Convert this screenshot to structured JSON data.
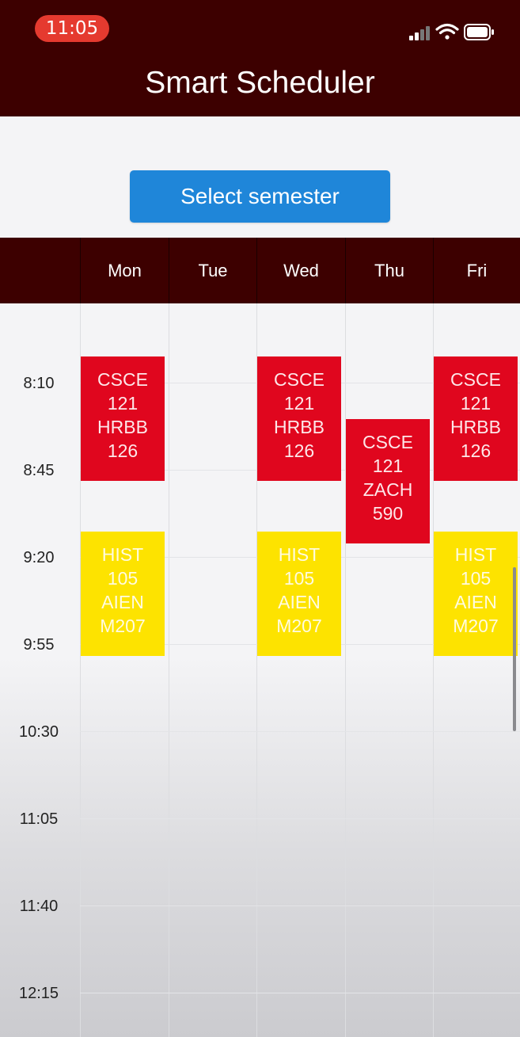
{
  "status_bar": {
    "time": "11:05",
    "icons": [
      "signal-icon",
      "wifi-icon",
      "battery-icon"
    ]
  },
  "header": {
    "title": "Smart Scheduler"
  },
  "semester_button": {
    "label": "Select semester"
  },
  "days": [
    "Mon",
    "Tue",
    "Wed",
    "Thu",
    "Fri"
  ],
  "time_labels": [
    "8:10",
    "8:45",
    "9:20",
    "9:55",
    "10:30",
    "11:05",
    "11:40",
    "12:15"
  ],
  "events": [
    {
      "day": "Mon",
      "lines": [
        "CSCE",
        "121",
        "HRBB",
        "126"
      ],
      "color": "red"
    },
    {
      "day": "Wed",
      "lines": [
        "CSCE",
        "121",
        "HRBB",
        "126"
      ],
      "color": "red"
    },
    {
      "day": "Fri",
      "lines": [
        "CSCE",
        "121",
        "HRBB",
        "126"
      ],
      "color": "red"
    },
    {
      "day": "Thu",
      "lines": [
        "CSCE",
        "121",
        "ZACH",
        "590"
      ],
      "color": "red"
    },
    {
      "day": "Mon",
      "lines": [
        "HIST",
        "105",
        "AIEN",
        "M207"
      ],
      "color": "yellow"
    },
    {
      "day": "Wed",
      "lines": [
        "HIST",
        "105",
        "AIEN",
        "M207"
      ],
      "color": "yellow"
    },
    {
      "day": "Fri",
      "lines": [
        "HIST",
        "105",
        "AIEN",
        "M207"
      ],
      "color": "yellow"
    }
  ],
  "colors": {
    "header_bg": "#3d0000",
    "button_bg": "#1f86d9",
    "event_red": "#e0061e",
    "event_yellow": "#fde300",
    "time_pill": "#e53a2f"
  }
}
